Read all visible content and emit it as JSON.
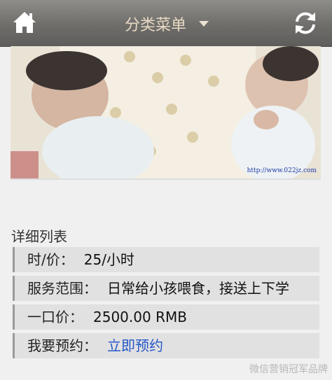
{
  "header": {
    "menu_label": "分类菜单"
  },
  "photo": {
    "url_watermark": "http://www.022jz.com"
  },
  "details": {
    "title": "详细列表",
    "rows": [
      {
        "label": "时/价：",
        "value": "25/小时"
      },
      {
        "label": "服务范围：",
        "value": "日常给小孩喂食，接送上下学"
      },
      {
        "label": "一口价：",
        "value": "2500.00 RMB"
      },
      {
        "label": "我要预约：",
        "link": "立即预约"
      }
    ]
  },
  "footer": {
    "watermark": "微信营销冠军品牌"
  },
  "colors": {
    "topbar": "#6f6d6a",
    "menu_text": "#e7d9c4",
    "link": "#2456c9",
    "row_bg": "#e2e1e2"
  }
}
